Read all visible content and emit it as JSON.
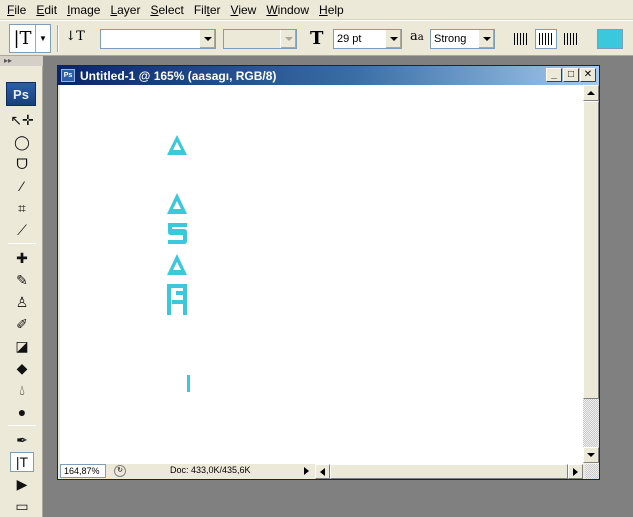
{
  "menu": {
    "items": [
      {
        "label": "File",
        "accel": "F"
      },
      {
        "label": "Edit",
        "accel": "E"
      },
      {
        "label": "Image",
        "accel": "I"
      },
      {
        "label": "Layer",
        "accel": "L"
      },
      {
        "label": "Select",
        "accel": "S"
      },
      {
        "label": "Filter",
        "accel": "T"
      },
      {
        "label": "View",
        "accel": "V"
      },
      {
        "label": "Window",
        "accel": "W"
      },
      {
        "label": "Help",
        "accel": "H"
      }
    ]
  },
  "options": {
    "font_family": "",
    "font_style": "",
    "font_size": "29 pt",
    "antialias": "Strong",
    "text_color": "#3cc8dc"
  },
  "toolbox": {
    "logo": "Ps"
  },
  "document": {
    "title": "Untitled-1 @ 165% (aasagı, RGB/8)",
    "icon_label": "Ps",
    "zoom": "164,87%",
    "doc_size": "Doc: 433,0K/435,6K",
    "text_color": "#3cc8dc"
  },
  "colors": {
    "ui_bg": "#ece9d8",
    "title_gradient_start": "#0a246a",
    "title_gradient_end": "#a6caf0",
    "workspace": "#808080",
    "glyph": "#3cc8dc"
  }
}
